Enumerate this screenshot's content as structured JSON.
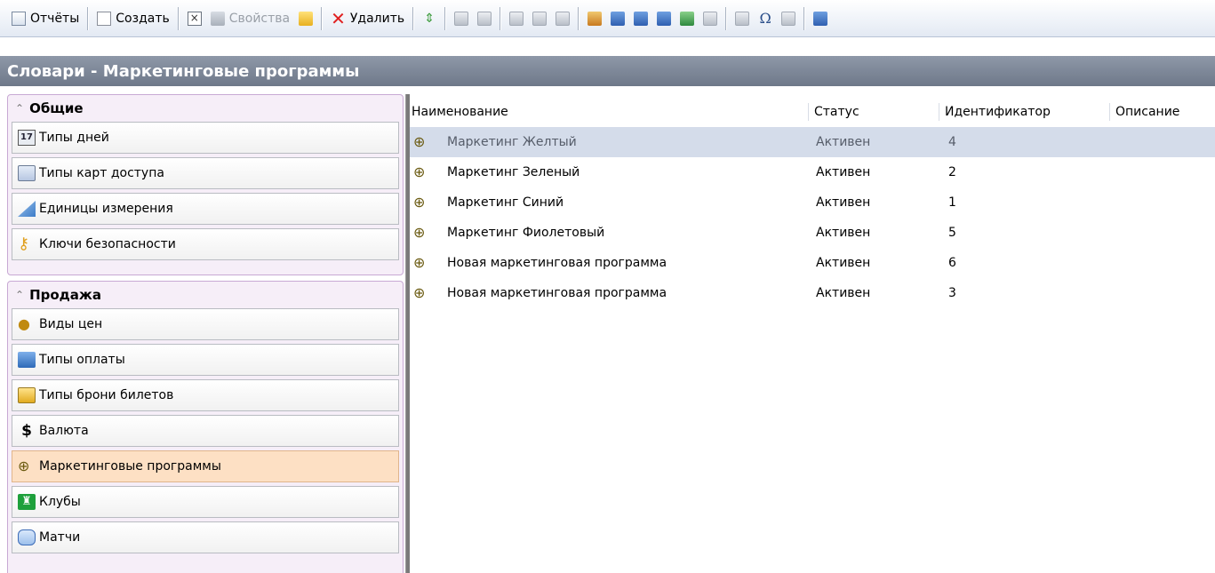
{
  "toolbar": {
    "reports_label": "Отчёты",
    "create_label": "Создать",
    "properties_label": "Свойства",
    "delete_label": "Удалить"
  },
  "title": "Словари - Маркетинговые программы",
  "sidebar": {
    "groups": [
      {
        "label": "Общие",
        "items": [
          "Типы дней",
          "Типы карт доступа",
          "Единицы измерения",
          "Ключи безопасности"
        ]
      },
      {
        "label": "Продажа",
        "items": [
          "Виды цен",
          "Типы оплаты",
          "Типы брони билетов",
          "Валюта",
          "Маркетинговые программы",
          "Клубы",
          "Матчи"
        ]
      }
    ],
    "calendar_glyph": "17"
  },
  "grid": {
    "columns": [
      "Наименование",
      "Статус",
      "Идентификатор",
      "Описание"
    ],
    "rows": [
      {
        "name": "Маркетинг Желтый",
        "status": "Активен",
        "id": "4",
        "description": ""
      },
      {
        "name": "Маркетинг Зеленый",
        "status": "Активен",
        "id": "2",
        "description": ""
      },
      {
        "name": "Маркетинг Синий",
        "status": "Активен",
        "id": "1",
        "description": ""
      },
      {
        "name": "Маркетинг Фиолетовый",
        "status": "Активен",
        "id": "5",
        "description": ""
      },
      {
        "name": "Новая маркетинговая программа",
        "status": "Активен",
        "id": "6",
        "description": ""
      },
      {
        "name": "Новая маркетинговая программа",
        "status": "Активен",
        "id": "3",
        "description": ""
      }
    ]
  },
  "colors": {
    "accent_active_item": "#fde0c4",
    "selected_row": "#d4dcea",
    "title_bar": "#7e8898",
    "delete_red": "#e02020"
  }
}
